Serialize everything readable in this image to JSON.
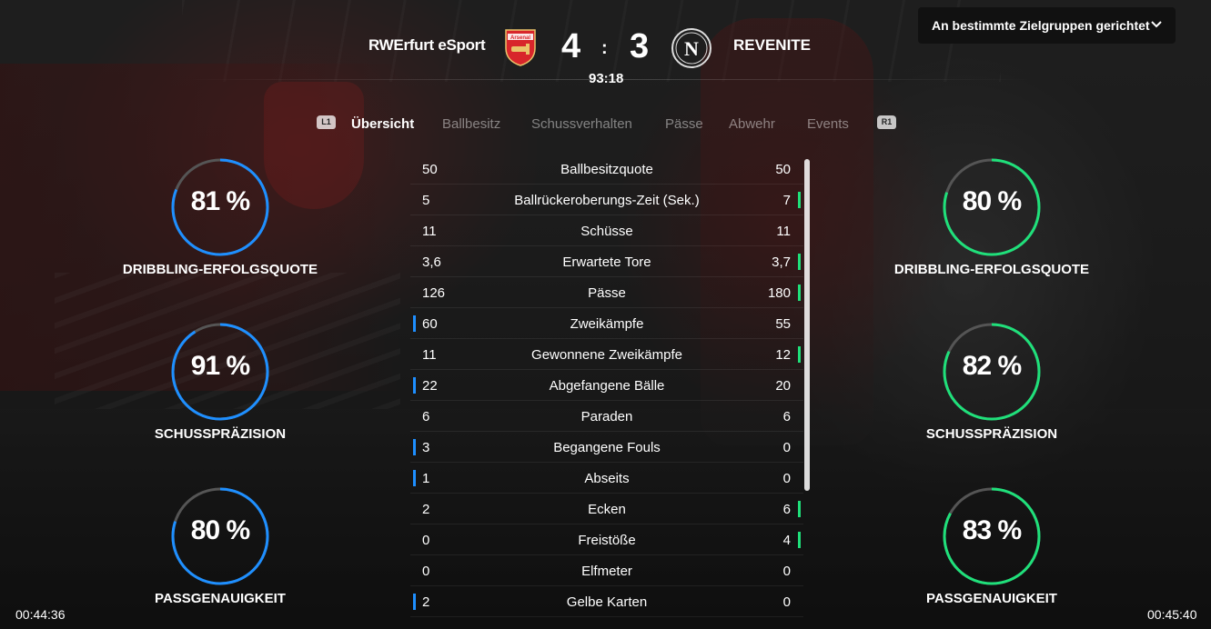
{
  "header": {
    "home_team": "RWErfurt eSport",
    "away_team": "REVENITE",
    "home_score": "4",
    "separator": ":",
    "away_score": "3",
    "match_clock": "93:18",
    "home_crest_text": "Arsenal",
    "away_crest_text": "N"
  },
  "audience_button": {
    "label": "An bestimmte Zielgruppen gerichtet",
    "icon": "chevron-down-icon"
  },
  "tabs": {
    "left_bumper": "L1",
    "right_bumper": "R1",
    "items": [
      "Übersicht",
      "Ballbesitz",
      "Schussverhalten",
      "Pässe",
      "Abwehr",
      "Events"
    ],
    "active": "Übersicht"
  },
  "stats": [
    {
      "label": "Ballbesitzquote",
      "home": "50",
      "away": "50",
      "leader": "none"
    },
    {
      "label": "Ballrückeroberungs-Zeit (Sek.)",
      "home": "5",
      "away": "7",
      "leader": "away"
    },
    {
      "label": "Schüsse",
      "home": "11",
      "away": "11",
      "leader": "none"
    },
    {
      "label": "Erwartete Tore",
      "home": "3,6",
      "away": "3,7",
      "leader": "away"
    },
    {
      "label": "Pässe",
      "home": "126",
      "away": "180",
      "leader": "away"
    },
    {
      "label": "Zweikämpfe",
      "home": "60",
      "away": "55",
      "leader": "home"
    },
    {
      "label": "Gewonnene Zweikämpfe",
      "home": "11",
      "away": "12",
      "leader": "away"
    },
    {
      "label": "Abgefangene Bälle",
      "home": "22",
      "away": "20",
      "leader": "home"
    },
    {
      "label": "Paraden",
      "home": "6",
      "away": "6",
      "leader": "none"
    },
    {
      "label": "Begangene Fouls",
      "home": "3",
      "away": "0",
      "leader": "home"
    },
    {
      "label": "Abseits",
      "home": "1",
      "away": "0",
      "leader": "home"
    },
    {
      "label": "Ecken",
      "home": "2",
      "away": "6",
      "leader": "away"
    },
    {
      "label": "Freistöße",
      "home": "0",
      "away": "4",
      "leader": "away"
    },
    {
      "label": "Elfmeter",
      "home": "0",
      "away": "0",
      "leader": "none"
    },
    {
      "label": "Gelbe Karten",
      "home": "2",
      "away": "0",
      "leader": "home"
    }
  ],
  "home_rings": [
    {
      "value": "81 %",
      "fraction": 0.81,
      "label": "DRIBBLING-ERFOLGSQUOTE"
    },
    {
      "value": "91 %",
      "fraction": 0.91,
      "label": "SCHUSSPRÄZISION"
    },
    {
      "value": "80 %",
      "fraction": 0.8,
      "label": "PASSGENAUIGKEIT"
    }
  ],
  "away_rings": [
    {
      "value": "80 %",
      "fraction": 0.8,
      "label": "DRIBBLING-ERFOLGSQUOTE"
    },
    {
      "value": "82 %",
      "fraction": 0.82,
      "label": "SCHUSSPRÄZISION"
    },
    {
      "value": "83 %",
      "fraction": 0.83,
      "label": "PASSGENAUIGKEIT"
    }
  ],
  "colors": {
    "home_accent": "#1e8fff",
    "away_accent": "#1fe07a",
    "ring_track": "#555555"
  },
  "video": {
    "current_time": "00:44:36",
    "total_time": "00:45:40"
  }
}
